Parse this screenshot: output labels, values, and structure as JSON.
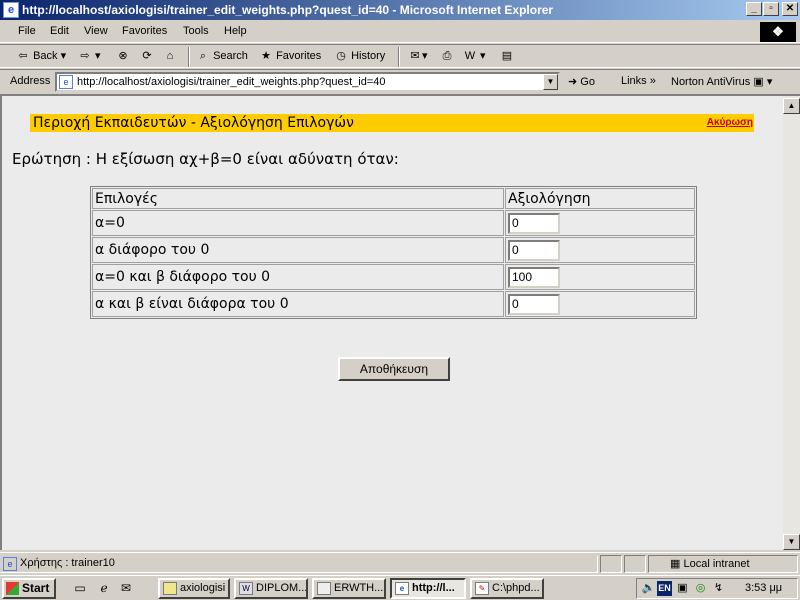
{
  "window": {
    "title": "http://localhost/axiologisi/trainer_edit_weights.php?quest_id=40 - Microsoft Internet Explorer",
    "minimize": "_",
    "maximize": "▫",
    "close": "✕"
  },
  "menu": [
    "File",
    "Edit",
    "View",
    "Favorites",
    "Tools",
    "Help"
  ],
  "toolbar": {
    "back": "Back",
    "search": "Search",
    "favorites": "Favorites",
    "history": "History"
  },
  "address": {
    "label": "Address",
    "url": "http://localhost/axiologisi/trainer_edit_weights.php?quest_id=40",
    "go": "Go",
    "links": "Links",
    "links_more": "»",
    "norton": "Norton AntiVirus"
  },
  "page": {
    "banner_title": "Περιοχή Εκπαιδευτών - Αξιολόγηση Επιλογών",
    "cancel_link": "Ακύρωση",
    "question": "Ερώτηση : Η εξίσωση αχ+β=0 είναι αδύνατη όταν:",
    "table": {
      "headers": [
        "Επιλογές",
        "Αξιολόγηση"
      ],
      "rows": [
        {
          "option": "α=0",
          "weight": "0"
        },
        {
          "option": "α διάφορο του 0",
          "weight": "0"
        },
        {
          "option": "α=0 και β διάφορο του 0",
          "weight": "100"
        },
        {
          "option": "α και β είναι διάφορα του 0",
          "weight": "0"
        }
      ]
    },
    "save_button": "Αποθήκευση"
  },
  "status": {
    "text": "Χρήστης : trainer10",
    "zone": "Local intranet"
  },
  "taskbar": {
    "start": "Start",
    "tasks": [
      "axiologisi",
      "DIPLOM...",
      "ERWTH...",
      "http://l...",
      "C:\\phpd..."
    ],
    "lang": "EN",
    "clock": "3:53 μμ"
  },
  "colors": {
    "banner": "#ffcc00",
    "cancel_link": "#cc0000",
    "titlebar_start": "#0a246a"
  }
}
